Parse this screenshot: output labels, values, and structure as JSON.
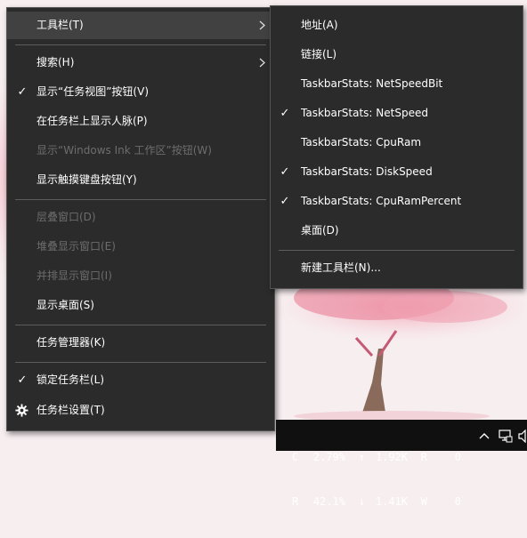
{
  "main_menu": {
    "toolbars": "工具栏(T)",
    "search": "搜索(H)",
    "show_task_view": "显示“任务视图”按钮(V)",
    "show_people": "在任务栏上显示人脉(P)",
    "show_ink": "显示“Windows Ink 工作区”按钮(W)",
    "show_keyboard": "显示触摸键盘按钮(Y)",
    "cascade": "层叠窗口(D)",
    "stacked": "堆叠显示窗口(E)",
    "side_by_side": "并排显示窗口(I)",
    "show_desktop": "显示桌面(S)",
    "task_manager": "任务管理器(K)",
    "lock_taskbar": "锁定任务栏(L)",
    "taskbar_settings": "任务栏设置(T)"
  },
  "sub_menu": {
    "address": "地址(A)",
    "links": "链接(L)",
    "netspeedbit": "TaskbarStats: NetSpeedBit",
    "netspeed": "TaskbarStats: NetSpeed",
    "cpuram": "TaskbarStats: CpuRam",
    "diskspeed": "TaskbarStats: DiskSpeed",
    "cpurampercent": "TaskbarStats: CpuRamPercent",
    "desktop": "桌面(D)",
    "new_toolbar": "新建工具栏(N)..."
  },
  "checkmark": "✓",
  "taskbar": {
    "cpu_label": "C",
    "cpu_value": "2.79%",
    "up_arrow": "↑",
    "up_value": "1.92K",
    "read_label": "R",
    "read_value": "0",
    "ram_label": "R",
    "ram_value": "42.1%",
    "down_arrow": "↓",
    "down_value": "1.41K",
    "write_label": "W",
    "write_value": "0"
  },
  "icons": {
    "submenu_arrow": "chevron-right-icon",
    "settings": "gear-icon",
    "tray_expand": "chevron-up-icon",
    "network": "network-icon",
    "volume": "speaker-icon"
  },
  "colors": {
    "menu_bg": "#2b2b2b",
    "hover_bg": "#414141",
    "disabled_text": "#6d6d6d",
    "taskbar_bg": "#101010"
  }
}
